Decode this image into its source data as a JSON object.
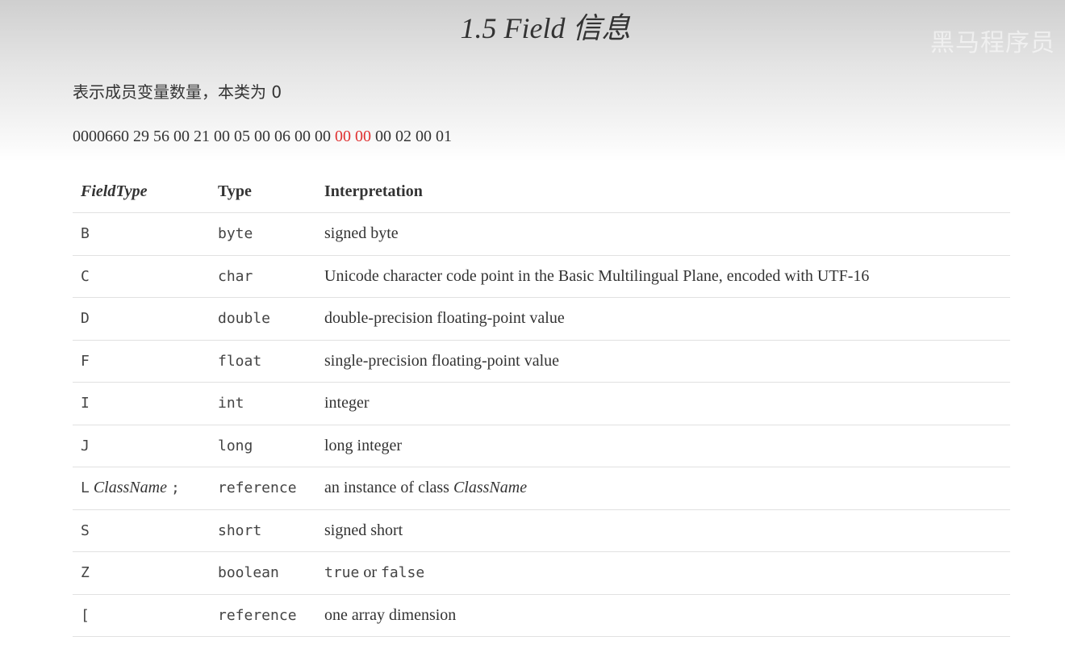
{
  "page": {
    "title": "1.5 Field 信息",
    "watermark": "黑马程序员",
    "description": "表示成员变量数量，本类为 0",
    "hex_prefix": "0000660 29 56 00 21 00 05 00 06 00 00",
    "hex_highlight": "00 00",
    "hex_suffix": "00 02 00 01"
  },
  "table": {
    "headers": [
      "FieldType",
      "Type",
      "Interpretation"
    ],
    "rows": [
      {
        "field_type": "B",
        "type": "byte",
        "interpretation": "signed byte"
      },
      {
        "field_type": "C",
        "type": "char",
        "interpretation": "Unicode character code point in the Basic Multilingual Plane, encoded with UTF-16"
      },
      {
        "field_type": "D",
        "type": "double",
        "interpretation": "double-precision floating-point value"
      },
      {
        "field_type": "F",
        "type": "float",
        "interpretation": "single-precision floating-point value"
      },
      {
        "field_type": "I",
        "type": "int",
        "interpretation": "integer"
      },
      {
        "field_type": "J",
        "type": "long",
        "interpretation": "long integer"
      },
      {
        "field_type_prefix": "L",
        "field_type_name": "ClassName",
        "field_type_suffix": ";",
        "type": "reference",
        "interpretation_prefix": "an instance of class",
        "interpretation_name": "ClassName"
      },
      {
        "field_type": "S",
        "type": "short",
        "interpretation": "signed short"
      },
      {
        "field_type": "Z",
        "type": "boolean",
        "interpretation_true": "true",
        "interpretation_or": "or",
        "interpretation_false": "false"
      },
      {
        "field_type": "[",
        "type": "reference",
        "interpretation": "one array dimension"
      }
    ]
  }
}
